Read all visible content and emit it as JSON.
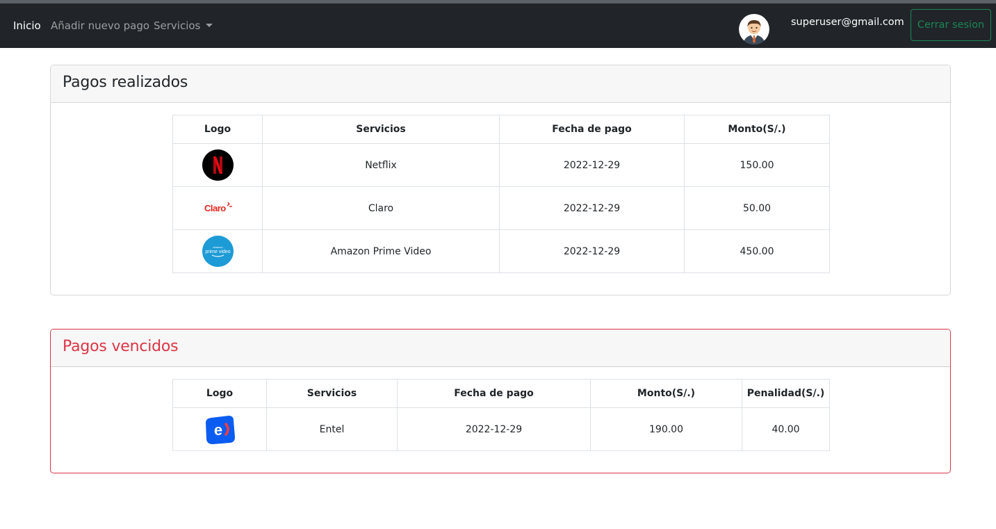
{
  "navbar": {
    "links": [
      {
        "label": "Inicio",
        "active": true
      },
      {
        "label": "Añadir nuevo pago",
        "active": false
      },
      {
        "label": "Servicios",
        "active": false
      }
    ],
    "user_email": "superuser@gmail.com",
    "logout_label": "Cerrar sesion"
  },
  "paid": {
    "title": "Pagos realizados",
    "columns": [
      "Logo",
      "Servicios",
      "Fecha de pago",
      "Monto(S/.)"
    ],
    "rows": [
      {
        "logo": "netflix-logo",
        "logo_text": "N",
        "service": "Netflix",
        "date": "2022-12-29",
        "amount": "150.00"
      },
      {
        "logo": "claro-logo",
        "logo_text": "Claro",
        "service": "Claro",
        "date": "2022-12-29",
        "amount": "50.00"
      },
      {
        "logo": "prime-video-logo",
        "logo_text": "prime video",
        "service": "Amazon Prime Video",
        "date": "2022-12-29",
        "amount": "450.00"
      }
    ]
  },
  "overdue": {
    "title": "Pagos vencidos",
    "columns": [
      "Logo",
      "Servicios",
      "Fecha de pago",
      "Monto(S/.)",
      "Penalidad(S/.)"
    ],
    "rows": [
      {
        "logo": "entel-logo",
        "logo_text": "e",
        "service": "Entel",
        "date": "2022-12-29",
        "amount": "190.00",
        "penalty": "40.00"
      }
    ]
  },
  "colors": {
    "navbar_bg": "#212529",
    "success": "#198754",
    "danger": "#dc3545",
    "netflix_red": "#e50914",
    "claro_red": "#e3261d",
    "prime_blue": "#1d9bd6",
    "entel_blue": "#0b5cf0"
  }
}
